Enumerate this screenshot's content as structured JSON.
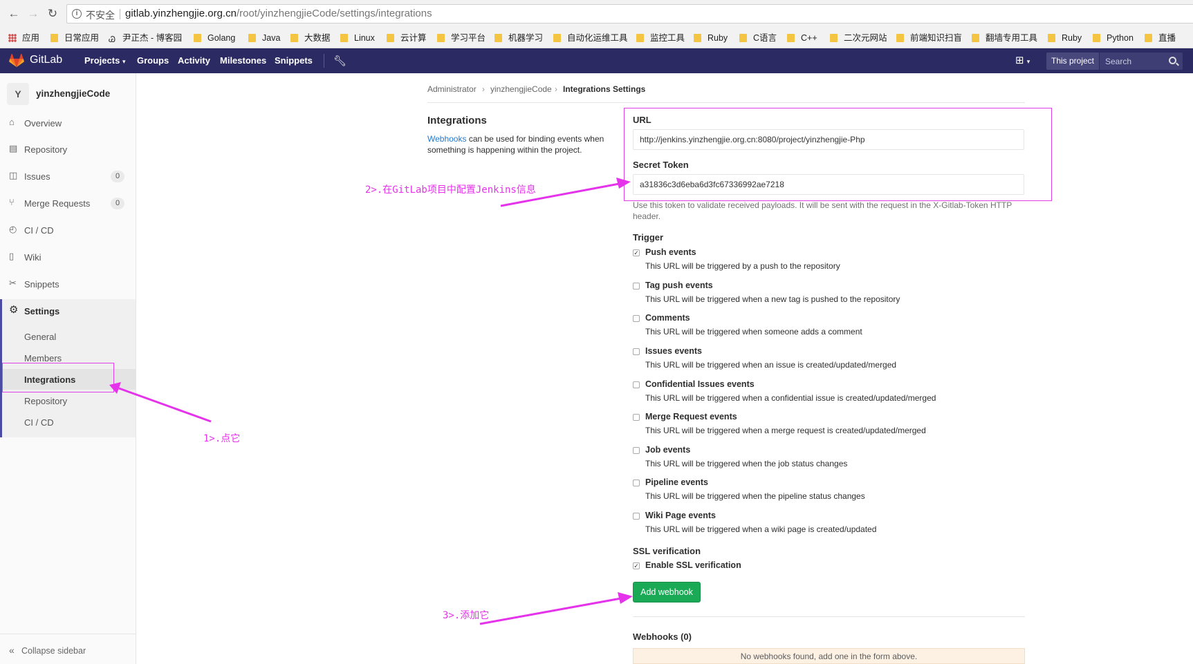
{
  "browser": {
    "insecure_label": "不安全",
    "url_host": "gitlab.yinzhengjie.org.cn",
    "url_path": "/root/yinzhengjieCode/settings/integrations",
    "bookmarks": [
      "应用",
      "日常应用",
      "尹正杰 - 博客园",
      "Golang",
      "Java",
      "大数据",
      "Linux",
      "云计算",
      "学习平台",
      "机器学习",
      "自动化运维工具",
      "监控工具",
      "Ruby",
      "C语言",
      "C++",
      "二次元网站",
      "前端知识扫盲",
      "翻墙专用工具",
      "Ruby",
      "Python",
      "直播"
    ]
  },
  "header": {
    "brand": "GitLab",
    "nav": [
      "Projects",
      "Groups",
      "Activity",
      "Milestones",
      "Snippets"
    ],
    "scope_button": "This project",
    "search_placeholder": "Search"
  },
  "sidebar": {
    "avatar_letter": "Y",
    "project_name": "yinzhengjieCode",
    "items": [
      {
        "label": "Overview",
        "icon": "home-icon"
      },
      {
        "label": "Repository",
        "icon": "doc-icon"
      },
      {
        "label": "Issues",
        "icon": "issues-icon",
        "badge": "0"
      },
      {
        "label": "Merge Requests",
        "icon": "merge-icon",
        "badge": "0"
      },
      {
        "label": "CI / CD",
        "icon": "rocket-icon"
      },
      {
        "label": "Wiki",
        "icon": "book-icon"
      },
      {
        "label": "Snippets",
        "icon": "scissors-icon"
      },
      {
        "label": "Settings",
        "icon": "gear-icon"
      }
    ],
    "settings_sub": [
      "General",
      "Members",
      "Integrations",
      "Repository",
      "CI / CD"
    ],
    "collapse_label": "Collapse sidebar"
  },
  "breadcrumb": [
    "Administrator",
    "yinzhengjieCode",
    "Integrations Settings"
  ],
  "integrations": {
    "title": "Integrations",
    "desc_link": "Webhooks",
    "desc_rest": " can be used for binding events when something is happening within the project."
  },
  "form": {
    "url_label": "URL",
    "url_value": "http://jenkins.yinzhengjie.org.cn:8080/project/yinzhengjie-Php",
    "token_label": "Secret Token",
    "token_value": "a31836c3d6eba6d3fc67336992ae7218",
    "token_help": "Use this token to validate received payloads. It will be sent with the request in the X-Gitlab-Token HTTP header.",
    "trigger_label": "Trigger",
    "triggers": [
      {
        "label": "Push events",
        "help": "This URL will be triggered by a push to the repository",
        "checked": true
      },
      {
        "label": "Tag push events",
        "help": "This URL will be triggered when a new tag is pushed to the repository",
        "checked": false
      },
      {
        "label": "Comments",
        "help": "This URL will be triggered when someone adds a comment",
        "checked": false
      },
      {
        "label": "Issues events",
        "help": "This URL will be triggered when an issue is created/updated/merged",
        "checked": false
      },
      {
        "label": "Confidential Issues events",
        "help": "This URL will be triggered when a confidential issue is created/updated/merged",
        "checked": false
      },
      {
        "label": "Merge Request events",
        "help": "This URL will be triggered when a merge request is created/updated/merged",
        "checked": false
      },
      {
        "label": "Job events",
        "help": "This URL will be triggered when the job status changes",
        "checked": false
      },
      {
        "label": "Pipeline events",
        "help": "This URL will be triggered when the pipeline status changes",
        "checked": false
      },
      {
        "label": "Wiki Page events",
        "help": "This URL will be triggered when a wiki page is created/updated",
        "checked": false
      }
    ],
    "ssl_label": "SSL verification",
    "ssl_checkbox": "Enable SSL verification",
    "ssl_checked": true,
    "add_button": "Add webhook"
  },
  "webhooks": {
    "title": "Webhooks (0)",
    "empty": "No webhooks found, add one in the form above."
  },
  "annotations": {
    "step1": "1>.点它",
    "step2": "2>.在GitLab项目中配置Jenkins信息",
    "step3": "3>.添加它",
    "color": "#e433ea"
  },
  "colors": {
    "header_bg": "#2b2a63",
    "accent_green": "#1aaa55",
    "link_blue": "#1f78d1"
  }
}
